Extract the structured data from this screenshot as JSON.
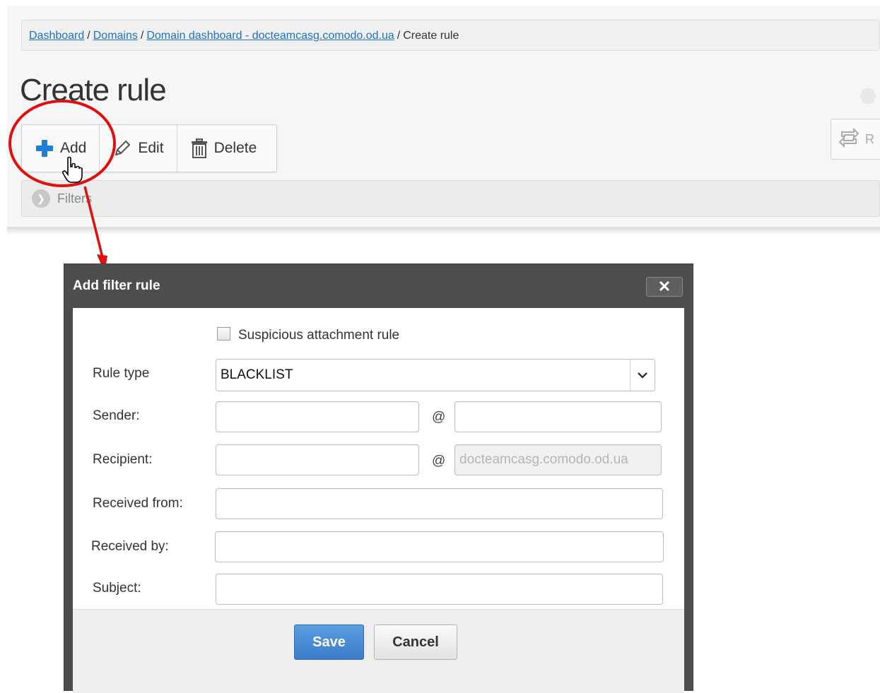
{
  "breadcrumb": {
    "links": [
      "Dashboard",
      "Domains",
      "Domain dashboard - docteamcasg.comodo.od.ua"
    ],
    "separator": "/",
    "current": "Create rule"
  },
  "page_title": "Create rule",
  "toolbar": {
    "add_label": "Add",
    "edit_label": "Edit",
    "delete_label": "Delete",
    "refresh_label": "R"
  },
  "filters_label": "Filters",
  "dialog": {
    "title": "Add filter rule",
    "close_glyph": "✕",
    "checkbox_label": "Suspicious attachment rule",
    "checkbox_checked": false,
    "rule_type_label": "Rule type",
    "rule_type_value": "BLACKLIST",
    "sender_label": "Sender:",
    "recipient_label": "Recipient:",
    "recipient_domain": "docteamcasg.comodo.od.ua",
    "at_symbol": "@",
    "received_from_label": "Received from:",
    "received_by_label": "Received by:",
    "subject_label": "Subject:",
    "save_label": "Save",
    "cancel_label": "Cancel"
  },
  "colors": {
    "accent_blue": "#3a7cc8",
    "annotation_red": "#e01010",
    "dialog_frame": "#4d4d4d"
  }
}
